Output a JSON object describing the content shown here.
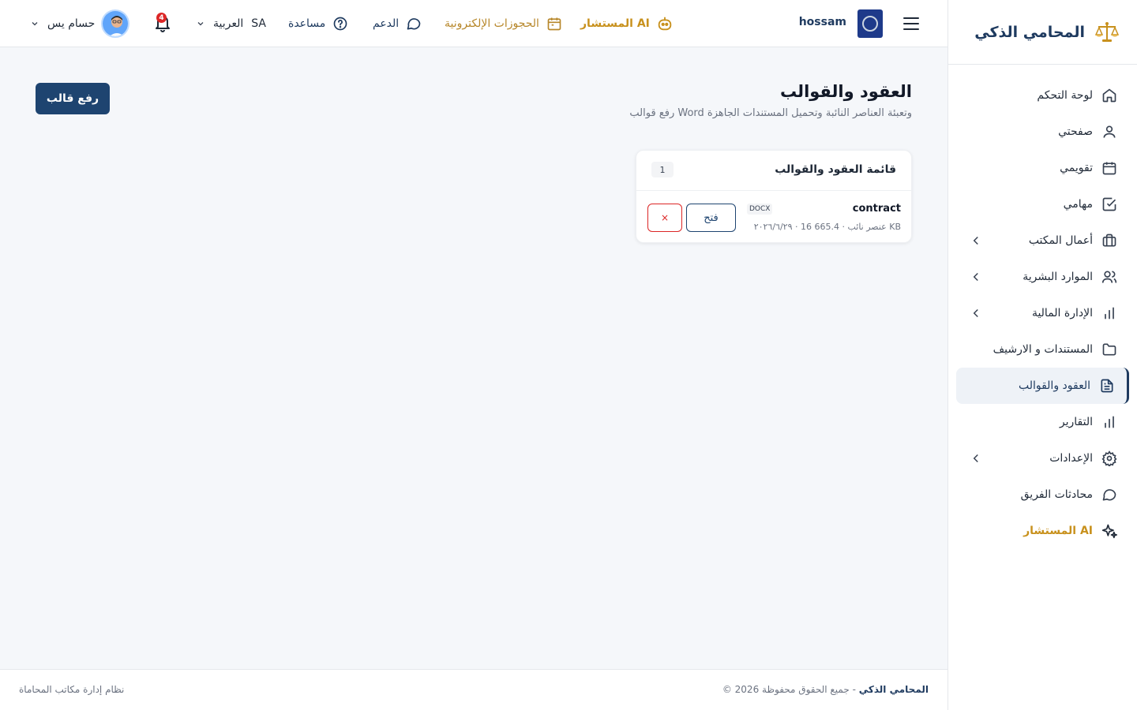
{
  "brand": {
    "name": "المحامي الذكي"
  },
  "sidebar": {
    "items": [
      {
        "label": "لوحة التحكم"
      },
      {
        "label": "صفحتي"
      },
      {
        "label": "تقويمي"
      },
      {
        "label": "مهامي"
      },
      {
        "label": "أعمال المكتب"
      },
      {
        "label": "الموارد البشرية"
      },
      {
        "label": "الإدارة المالية"
      },
      {
        "label": "المستندات و الارشيف"
      },
      {
        "label": "العقود والقوالب"
      },
      {
        "label": "التقارير"
      },
      {
        "label": "الإعدادات"
      },
      {
        "label": "محادثات الفريق"
      },
      {
        "label": "المستشار AI"
      }
    ]
  },
  "header": {
    "username": "hossam",
    "ai_link": "المستشار AI",
    "bookings_link": "الحجوزات الإلكترونية",
    "support_link": "الدعم",
    "help_link": "مساعدة",
    "language": "العربية",
    "language_code": "SA",
    "notification_count": "4",
    "profile_name": "حسام يس"
  },
  "page": {
    "title": "العقود والقوالب",
    "subtitle": "رفع قوالب Word وتعبئة العناصر النائبة وتحميل المستندات الجاهزة",
    "upload_button": "رفع قالب"
  },
  "card": {
    "title": "قائمة العقود والقوالب",
    "count": "1",
    "rows": [
      {
        "name": "contract",
        "type": "DOCX",
        "meta": "٢٠٢٦/٦/٢٩ · 16 عنصر نائب · 665.4 KB",
        "open_label": "فتح",
        "delete_label": "×"
      }
    ]
  },
  "footer": {
    "copyright_prefix": "© 2026",
    "copyright_brand": "المحامي الذكي",
    "copyright_suffix": "- جميع الحقوق محفوظة",
    "system_name": "نظام إدارة مكاتب المحاماة"
  },
  "colors": {
    "primary": "#1e3a5f",
    "accent_gold": "#c8911d",
    "danger": "#dc2626",
    "background": "#f5f7fa"
  }
}
